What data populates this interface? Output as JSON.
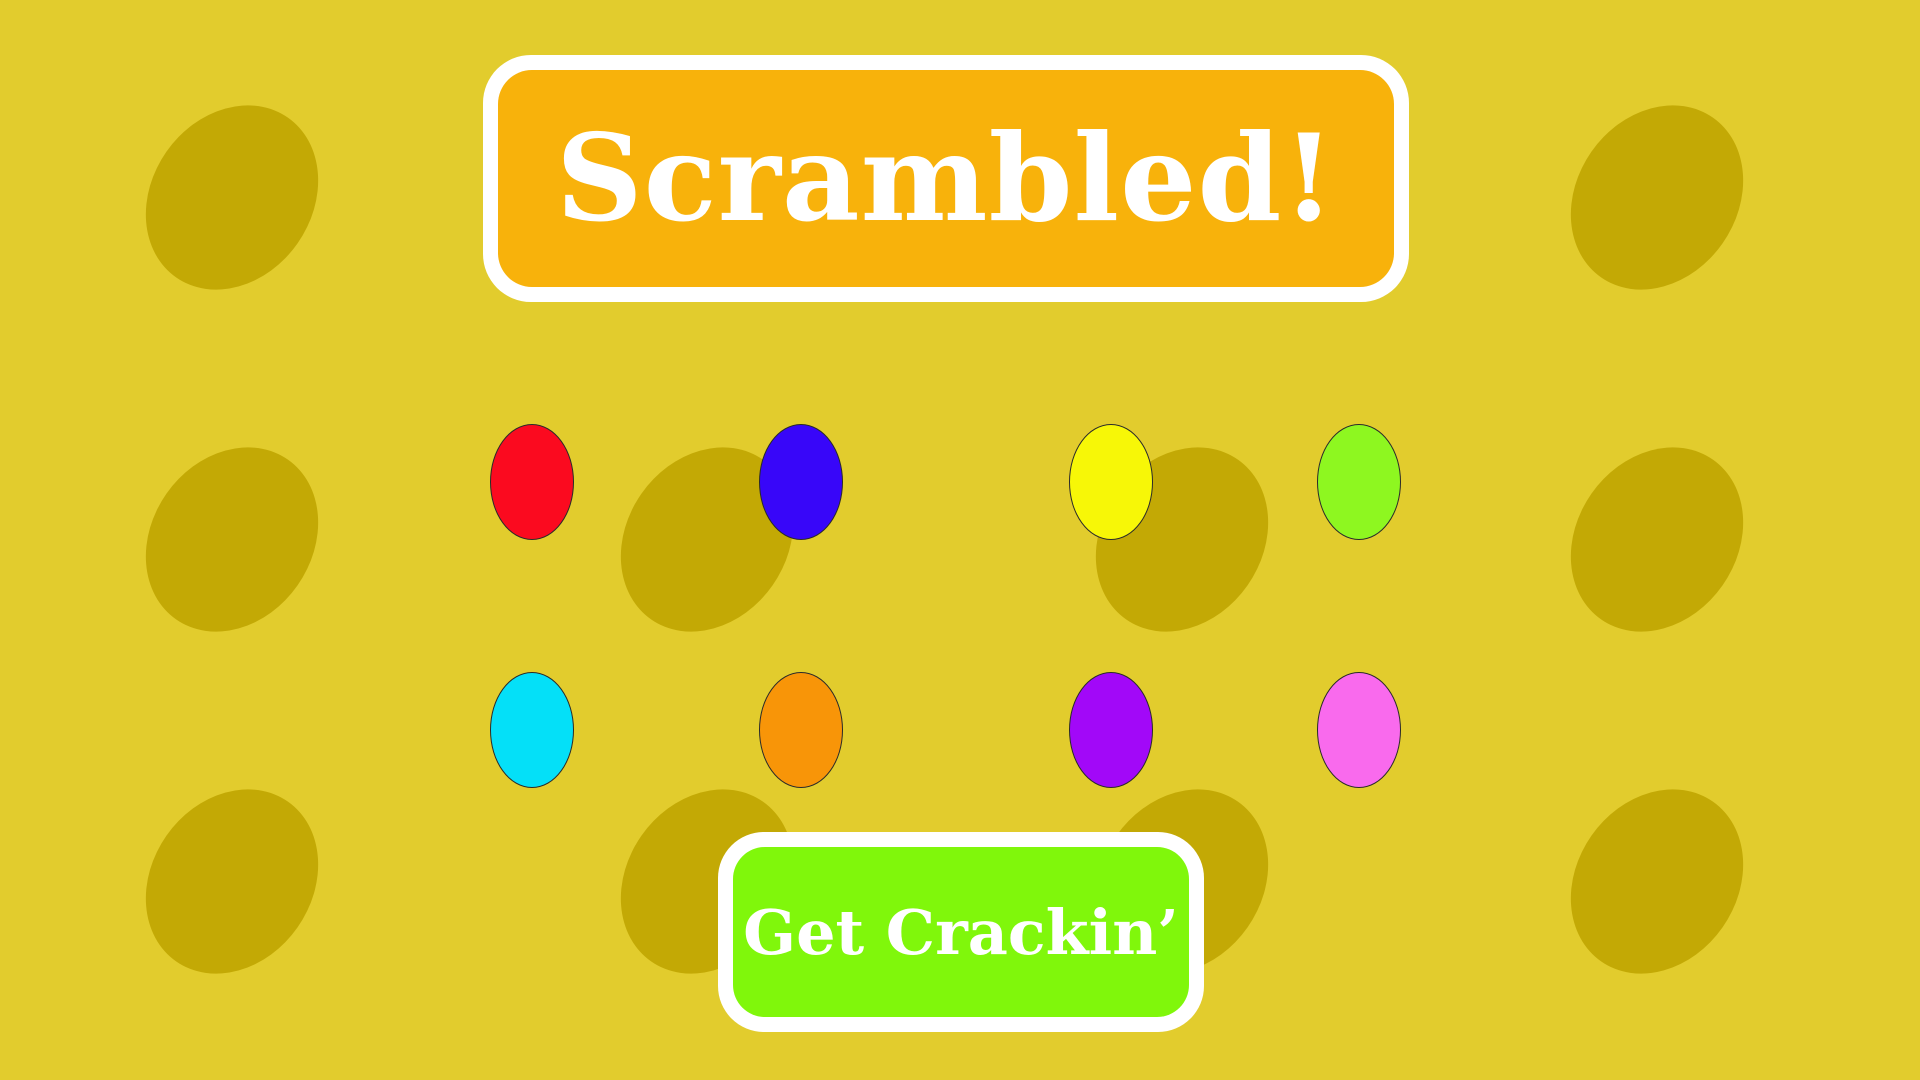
{
  "title": "Scrambled!",
  "start_button": {
    "label": "Get Crackin’"
  },
  "colors": {
    "background": "#e2cc2d",
    "background_egg": "#c3a905",
    "title_panel": "#f8b20b",
    "button": "#80f70b",
    "border": "#ffffff"
  },
  "eggs": [
    {
      "name": "red",
      "color": "#fb0a1f"
    },
    {
      "name": "blue",
      "color": "#3806f9"
    },
    {
      "name": "yellow",
      "color": "#f7f707"
    },
    {
      "name": "lime",
      "color": "#8ef720"
    },
    {
      "name": "cyan",
      "color": "#04e0f8"
    },
    {
      "name": "orange",
      "color": "#f89508"
    },
    {
      "name": "purple",
      "color": "#a208f8"
    },
    {
      "name": "pink",
      "color": "#f96aed"
    }
  ]
}
